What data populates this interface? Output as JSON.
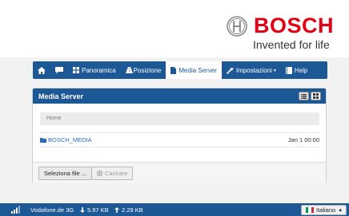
{
  "brand": {
    "logo_text": "BOSCH",
    "tagline": "Invented for life",
    "logo_color": "#e20015"
  },
  "nav": {
    "items": [
      {
        "label": "",
        "icon": "home-icon"
      },
      {
        "label": "",
        "icon": "chat-icon"
      },
      {
        "label": "Panoramica",
        "icon": "grid-icon"
      },
      {
        "label": "Posizione",
        "icon": "road-icon"
      },
      {
        "label": "Media Server",
        "icon": "file-icon",
        "active": true
      },
      {
        "label": "Impostazioni",
        "icon": "wrench-icon",
        "dropdown": true
      },
      {
        "label": "Help",
        "icon": "book-icon"
      }
    ],
    "bg_color": "#1d5896"
  },
  "panel": {
    "title": "Media Server",
    "breadcrumb": "Home",
    "files": [
      {
        "name": "BOSCH_MEDIA",
        "date": "Jan 1 00:00",
        "icon": "folder-icon"
      }
    ],
    "select_button": "Seleziona file ...",
    "upload_button": "Caricare"
  },
  "status": {
    "carrier": "Vodafone.de 3G",
    "download": "5.97 KB",
    "upload": "2.29 KB",
    "language": "Italiano"
  }
}
